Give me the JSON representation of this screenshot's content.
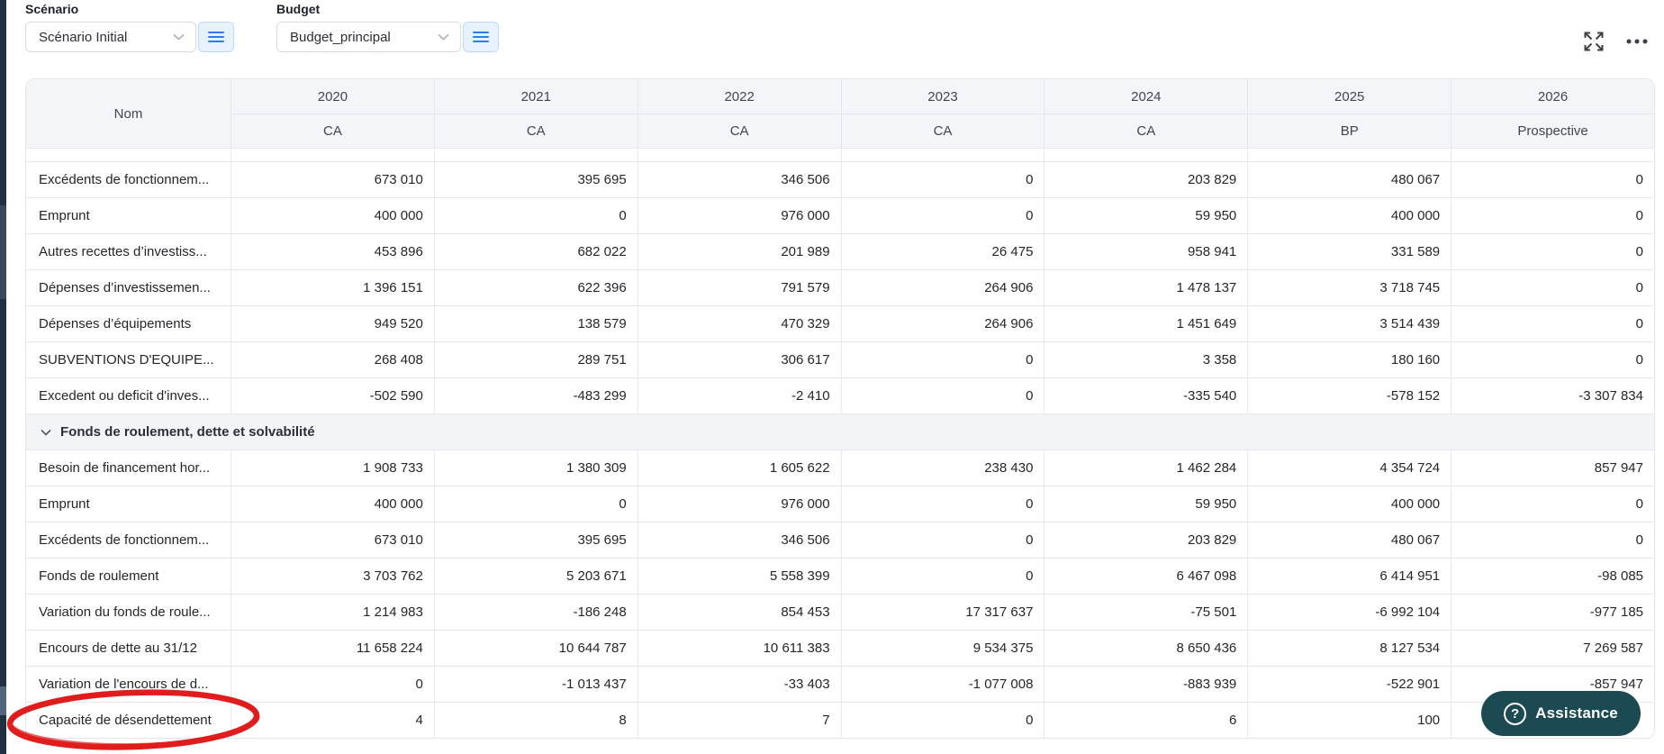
{
  "scenario": {
    "label": "Scénario",
    "value": "Scénario Initial"
  },
  "budget": {
    "label": "Budget",
    "value": "Budget_principal"
  },
  "icons": {
    "scenario_menu": "hamburger-icon",
    "budget_menu": "hamburger-icon",
    "expand": "expand-icon",
    "more": "more-ellipsis-icon",
    "section_chevron": "chevron-down-icon",
    "select_chevron": "chevron-down-icon",
    "assistance_icon": "question-circle-icon"
  },
  "colors": {
    "accent_blue": "#2e7cf0",
    "button_bg_blue": "#e8f2fe",
    "header_bg": "#f4f5f9",
    "border": "#e7e9ee",
    "assistance_teal": "#1b4a52",
    "annotation_red": "#e01d1d",
    "sidebar_dark": "#203040"
  },
  "assistance": {
    "label": "Assistance"
  },
  "table": {
    "name_header": "Nom",
    "columns": [
      {
        "year": "2020",
        "type": "CA"
      },
      {
        "year": "2021",
        "type": "CA"
      },
      {
        "year": "2022",
        "type": "CA"
      },
      {
        "year": "2023",
        "type": "CA"
      },
      {
        "year": "2024",
        "type": "CA"
      },
      {
        "year": "2025",
        "type": "BP"
      },
      {
        "year": "2026",
        "type": "Prospective"
      }
    ],
    "rows_before_section": [
      {
        "name": "Excédents de fonctionnem...",
        "values": [
          "673 010",
          "395 695",
          "346 506",
          "0",
          "203 829",
          "480 067",
          "0"
        ]
      },
      {
        "name": "Emprunt",
        "values": [
          "400 000",
          "0",
          "976 000",
          "0",
          "59 950",
          "400 000",
          "0"
        ]
      },
      {
        "name": "Autres recettes d’investiss...",
        "values": [
          "453 896",
          "682 022",
          "201 989",
          "26 475",
          "958 941",
          "331 589",
          "0"
        ]
      },
      {
        "name": "Dépenses d’investissemen...",
        "values": [
          "1 396 151",
          "622 396",
          "791 579",
          "264 906",
          "1 478 137",
          "3 718 745",
          "0"
        ]
      },
      {
        "name": "Dépenses d’équipements",
        "values": [
          "949 520",
          "138 579",
          "470 329",
          "264 906",
          "1 451 649",
          "3 514 439",
          "0"
        ]
      },
      {
        "name": "SUBVENTIONS D'EQUIPE...",
        "values": [
          "268 408",
          "289 751",
          "306 617",
          "0",
          "3 358",
          "180 160",
          "0"
        ]
      },
      {
        "name": "Excedent ou deficit d'inves...",
        "values": [
          "-502 590",
          "-483 299",
          "-2 410",
          "0",
          "-335 540",
          "-578 152",
          "-3 307 834"
        ]
      }
    ],
    "section": {
      "title": "Fonds de roulement, dette et solvabilité"
    },
    "rows_after_section": [
      {
        "name": "Besoin de financement hor...",
        "values": [
          "1 908 733",
          "1 380 309",
          "1 605 622",
          "238 430",
          "1 462 284",
          "4 354 724",
          "857 947"
        ]
      },
      {
        "name": "Emprunt",
        "values": [
          "400 000",
          "0",
          "976 000",
          "0",
          "59 950",
          "400 000",
          "0"
        ]
      },
      {
        "name": "Excédents de fonctionnem...",
        "values": [
          "673 010",
          "395 695",
          "346 506",
          "0",
          "203 829",
          "480 067",
          "0"
        ]
      },
      {
        "name": "Fonds de roulement",
        "values": [
          "3 703 762",
          "5 203 671",
          "5 558 399",
          "0",
          "6 467 098",
          "6 414 951",
          "-98 085"
        ]
      },
      {
        "name": "Variation du fonds de roule...",
        "values": [
          "1 214 983",
          "-186 248",
          "854 453",
          "17 317 637",
          "-75 501",
          "-6 992 104",
          "-977 185"
        ]
      },
      {
        "name": "Encours de dette au 31/12",
        "values": [
          "11 658 224",
          "10 644 787",
          "10 611 383",
          "9 534 375",
          "8 650 436",
          "8 127 534",
          "7 269 587"
        ]
      },
      {
        "name": "Variation de l'encours de d...",
        "values": [
          "0",
          "-1 013 437",
          "-33 403",
          "-1 077 008",
          "-883 939",
          "-522 901",
          "-857 947"
        ]
      },
      {
        "name": "Capacité de désendettement",
        "values": [
          "4",
          "8",
          "7",
          "0",
          "6",
          "100",
          ""
        ]
      }
    ]
  }
}
